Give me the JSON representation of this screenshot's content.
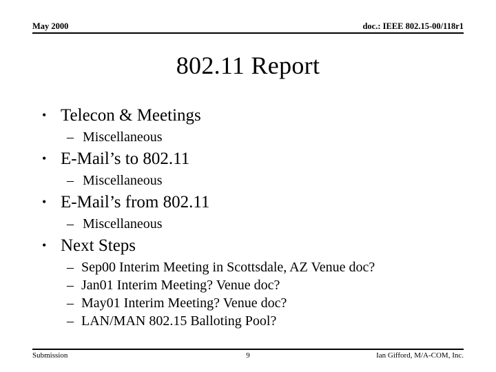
{
  "slide": {
    "header": {
      "left": "May 2000",
      "right": "doc.: IEEE 802.15-00/118r1"
    },
    "title": "802.11 Report",
    "bullets": [
      {
        "level": 1,
        "marker": "•",
        "text": "Telecon & Meetings",
        "children": [
          {
            "level": 2,
            "marker": "–",
            "text": "Miscellaneous"
          }
        ]
      },
      {
        "level": 1,
        "marker": "•",
        "text": "E-Mail’s to 802.11",
        "children": [
          {
            "level": 2,
            "marker": "–",
            "text": "Miscellaneous"
          }
        ]
      },
      {
        "level": 1,
        "marker": "•",
        "text": "E-Mail’s from 802.11",
        "children": [
          {
            "level": 2,
            "marker": "–",
            "text": "Miscellaneous"
          }
        ]
      },
      {
        "level": 1,
        "marker": "•",
        "text": "Next Steps",
        "children": [
          {
            "level": 3,
            "marker": "–",
            "text": "Sep00 Interim Meeting in Scottsdale, AZ Venue doc?"
          },
          {
            "level": 3,
            "marker": "–",
            "text": "Jan01 Interim Meeting?  Venue doc?"
          },
          {
            "level": 3,
            "marker": "–",
            "text": "May01 Interim Meeting? Venue doc?"
          },
          {
            "level": 3,
            "marker": "–",
            "text": "LAN/MAN 802.15 Balloting Pool?"
          }
        ]
      }
    ],
    "footer": {
      "left": "Submission",
      "page": "9",
      "right": "Ian Gifford, M/A-COM, Inc."
    },
    "colors": {
      "background": "#ffffff",
      "text": "#000000",
      "rule": "#000000"
    }
  }
}
